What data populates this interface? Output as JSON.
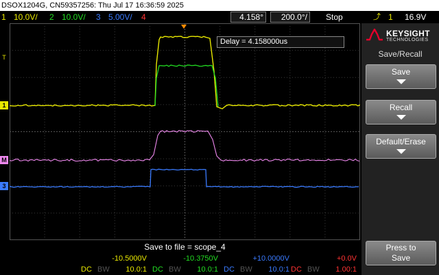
{
  "title": "DSOX1204G, CN59357256: Thu Jul 17 16:36:59 2025",
  "topbar": {
    "ch1_num": "1",
    "ch1_scale": "10.0V/",
    "ch2_num": "2",
    "ch2_scale": "10.0V/",
    "ch3_num": "3",
    "ch3_scale": "5.00V/",
    "ch4_num": "4",
    "time_pos": "4.158°",
    "time_scale": "200.0°/",
    "run_state": "Stop",
    "trigger_source": "1",
    "trigger_level": "16.9V"
  },
  "delay_readout": "Delay = 4.158000us",
  "side_menu": {
    "brand": "KEYSIGHT",
    "brand_sub": "TECHNOLOGIES",
    "title": "Save/Recall",
    "btn_save": "Save",
    "btn_recall": "Recall",
    "btn_default": "Default/Erase",
    "btn_press_1": "Press to",
    "btn_press_2": "Save"
  },
  "status_text": "Save to file = scope_4",
  "channels": [
    {
      "offset": "-10.5000V",
      "coupling": "DC",
      "bw": "BW",
      "probe": "10.0:1",
      "color": "#e8e800"
    },
    {
      "offset": "-10.3750V",
      "coupling": "DC",
      "bw": "BW",
      "probe": "10.0:1",
      "color": "#22dd22"
    },
    {
      "offset": "+10.0000V",
      "coupling": "DC",
      "bw": "BW",
      "probe": "10.0:1",
      "color": "#3a7bff"
    },
    {
      "offset": "+0.0V",
      "coupling": "DC",
      "bw": "BW",
      "probe": "1.00:1",
      "color": "#ff3333"
    }
  ],
  "colors": {
    "ch1": "#e8e800",
    "ch2": "#22dd22",
    "ch3": "#3a7bff",
    "ch4": "#ff3333",
    "math": "#ee88ee"
  }
}
